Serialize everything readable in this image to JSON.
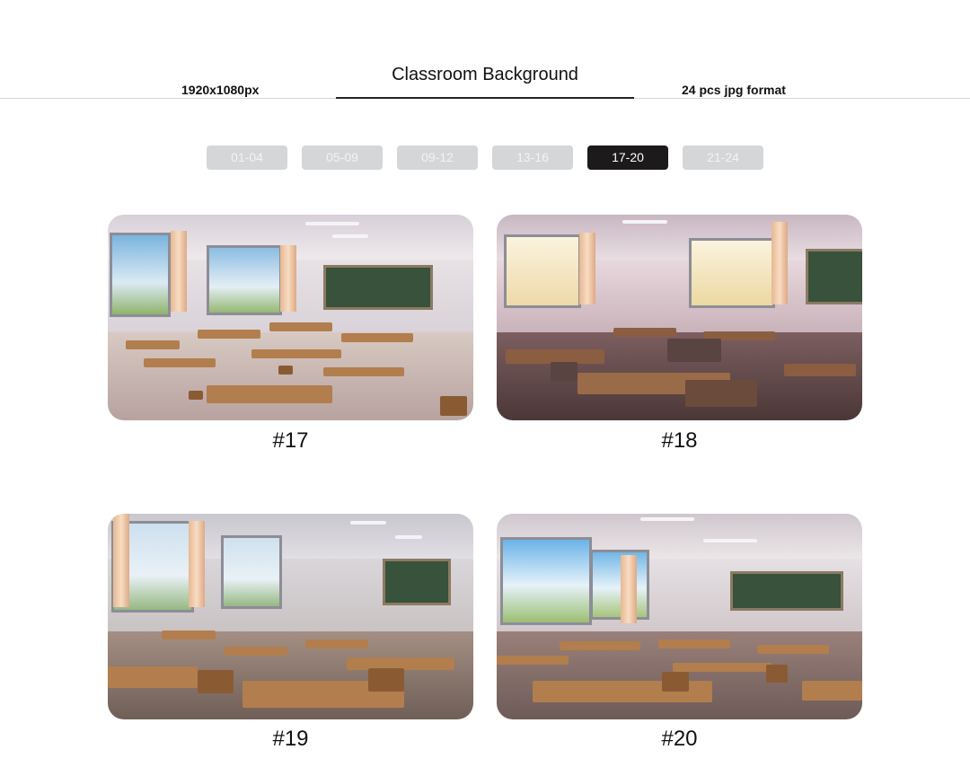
{
  "header": {
    "title": "Classroom Background",
    "resolution": "1920x1080px",
    "format": "24 pcs jpg format"
  },
  "pager": {
    "items": [
      "01-04",
      "05-09",
      "09-12",
      "13-16",
      "17-20",
      "21-24"
    ],
    "active": "17-20"
  },
  "cards": [
    {
      "label": "#17"
    },
    {
      "label": "#18"
    },
    {
      "label": "#19"
    },
    {
      "label": "#20"
    }
  ],
  "colors": {
    "active_pill": "#1c1a1b",
    "inactive_pill": "#d4d6d7",
    "desk": "#b27e4d",
    "board": "#38523b"
  }
}
